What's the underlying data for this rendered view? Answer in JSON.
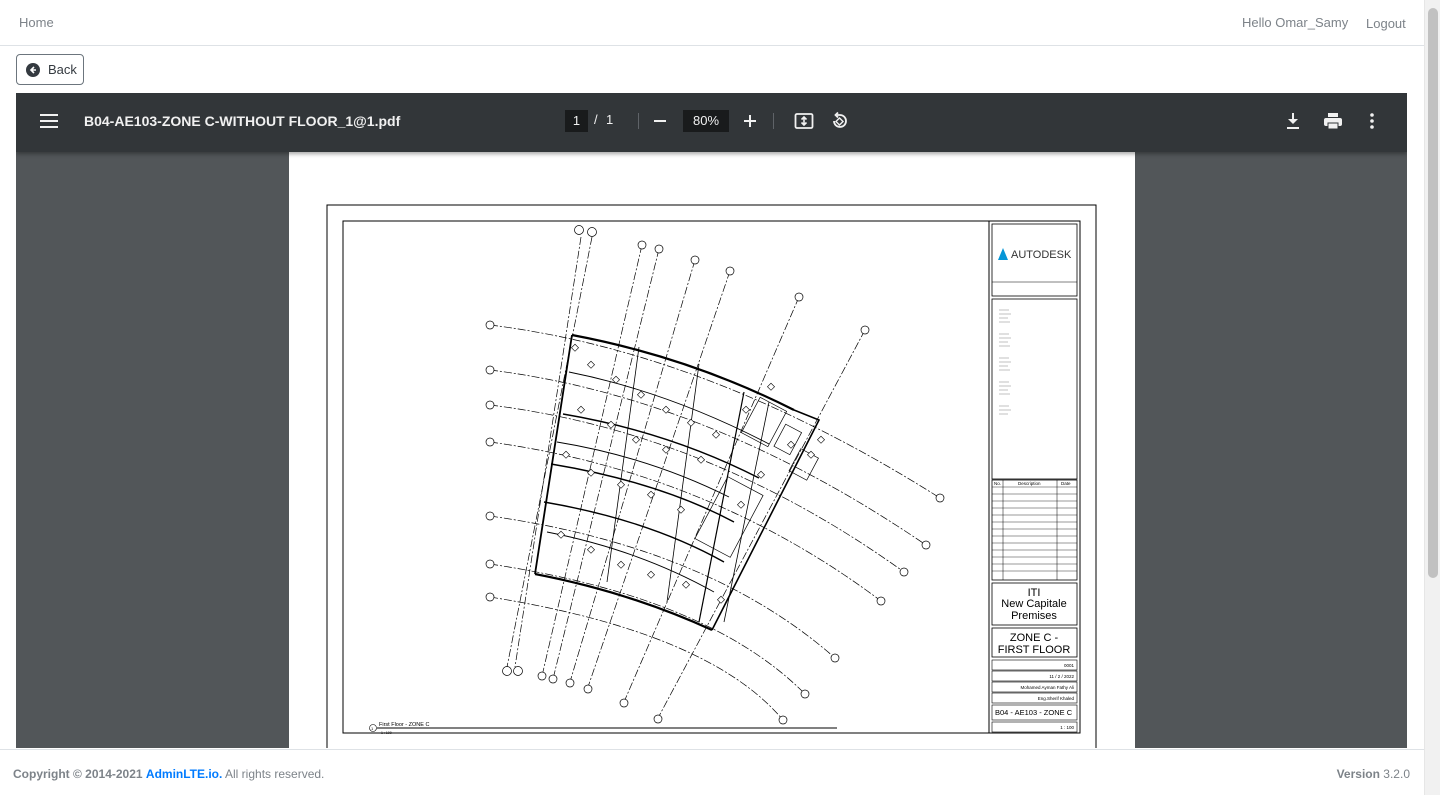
{
  "navbar": {
    "home_label": "Home",
    "greeting": "Hello Omar_Samy",
    "logout_label": "Logout"
  },
  "back_button": {
    "label": "Back"
  },
  "pdf_viewer": {
    "file_title": "B04-AE103-ZONE C-WITHOUT FLOOR_1@1.pdf",
    "current_page": "1",
    "page_separator": "/",
    "total_pages": "1",
    "zoom": "80%",
    "icons": {
      "menu": "menu-icon",
      "zoom_out": "minus-icon",
      "zoom_in": "plus-icon",
      "fit": "fit-page-icon",
      "rotate": "rotate-icon",
      "download": "download-icon",
      "print": "print-icon",
      "more": "more-vertical-icon"
    }
  },
  "drawing": {
    "logo_text": "AUTODESK",
    "client_line1": "ITI",
    "client_line2": "New Capitale",
    "client_line3": "Premises",
    "sheet_title_line1": "ZONE C -",
    "sheet_title_line2": "FIRST FLOOR",
    "revision_headers": [
      "No.",
      "Description",
      "Date"
    ],
    "project_number": "0001",
    "date": "11 / 2 / 2022",
    "drawn_by": "Mohamed Ayman Fathy Ali",
    "checked_by": "Eng.Sherif Khaled",
    "sheet_number": "B04 - AE103 - ZONE C",
    "scale": "1 : 100",
    "view_title": "First Floor - ZONE C",
    "view_number": "1",
    "view_scale": "1 : 100"
  },
  "footer": {
    "copyright_prefix": "Copyright © 2014-2021",
    "brand_link": "AdminLTE.io.",
    "rights": "All rights reserved.",
    "version_label": "Version",
    "version_value": "3.2.0"
  },
  "colors": {
    "toolbar_bg": "#323639",
    "viewer_bg": "#525659",
    "link_blue": "#007bff",
    "autodesk_teal": "#0696d7"
  }
}
